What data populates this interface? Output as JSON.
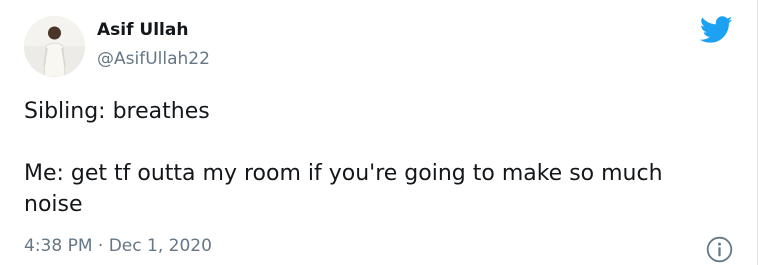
{
  "author": {
    "display_name": "Asif Ullah",
    "handle": "@AsifUllah22"
  },
  "tweet": {
    "text_line_1": "Sibling: breathes",
    "text_line_2": "Me: get tf outta my room if you're going to make so much noise",
    "time": "4:38 PM",
    "separator": "·",
    "date": "Dec 1, 2020"
  },
  "icons": {
    "brand": "twitter-bird-icon",
    "info": "info-icon",
    "brand_color": "#1da1f2",
    "muted_color": "#657786"
  }
}
